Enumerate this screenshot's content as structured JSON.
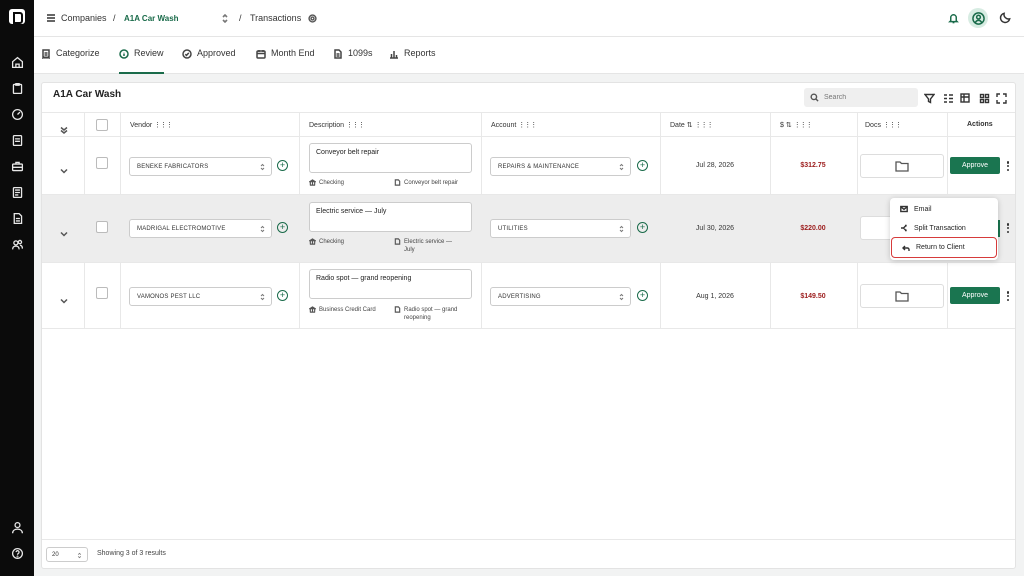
{
  "topbar": {
    "breadcrumb_companies": "Companies",
    "breadcrumb_separator": "/",
    "company_name": "A1A Car Wash",
    "page_name": "Transactions"
  },
  "tabs": [
    {
      "label": "Categorize",
      "icon": "receipt-icon",
      "active": false
    },
    {
      "label": "Review",
      "icon": "info-icon",
      "active": true
    },
    {
      "label": "Approved",
      "icon": "check-circle-icon",
      "active": false
    },
    {
      "label": "Month End",
      "icon": "calendar-icon",
      "active": false
    },
    {
      "label": "1099s",
      "icon": "document-icon",
      "active": false
    },
    {
      "label": "Reports",
      "icon": "bar-chart-icon",
      "active": false
    }
  ],
  "card": {
    "title": "A1A Car Wash",
    "search_placeholder": "Search"
  },
  "columns": {
    "vendor": "Vendor",
    "description": "Description",
    "account": "Account",
    "date": "Date",
    "amount": "$",
    "docs": "Docs",
    "actions": "Actions"
  },
  "rows": [
    {
      "vendor": "BENEKE FABRICATORS",
      "description": "Conveyor belt repair",
      "payment_source": "Checking",
      "memo": "Conveyor belt repair",
      "account": "REPAIRS & MAINTENANCE",
      "date": "Jul 28, 2026",
      "amount": "$312.75",
      "approve_label": "Approve"
    },
    {
      "vendor": "MADRIGAL ELECTROMOTIVE",
      "description": "Electric service — July",
      "payment_source": "Checking",
      "memo": "Electric service — July",
      "account": "UTILITIES",
      "date": "Jul 30, 2026",
      "amount": "$220.00",
      "approve_label": "Approve"
    },
    {
      "vendor": "VAMONOS PEST LLC",
      "description": "Radio spot — grand reopening",
      "payment_source": "Business Credit Card",
      "memo": "Radio spot — grand reopening",
      "account": "ADVERTISING",
      "date": "Aug 1, 2026",
      "amount": "$149.50",
      "approve_label": "Approve"
    }
  ],
  "actions_menu": {
    "items": [
      {
        "label": "Email",
        "icon": "mail-icon"
      },
      {
        "label": "Split Transaction",
        "icon": "split-icon"
      },
      {
        "label": "Return to Client",
        "icon": "return-icon"
      }
    ]
  },
  "footer": {
    "page_size": "20",
    "showing": "Showing 3 of 3 results"
  },
  "colors": {
    "brand_green": "#1a6b4a",
    "approve_button": "#1a7550",
    "amount_red": "#9c1c1c",
    "sidebar": "#0b0b0b",
    "highlight_border": "#d63b3b"
  }
}
